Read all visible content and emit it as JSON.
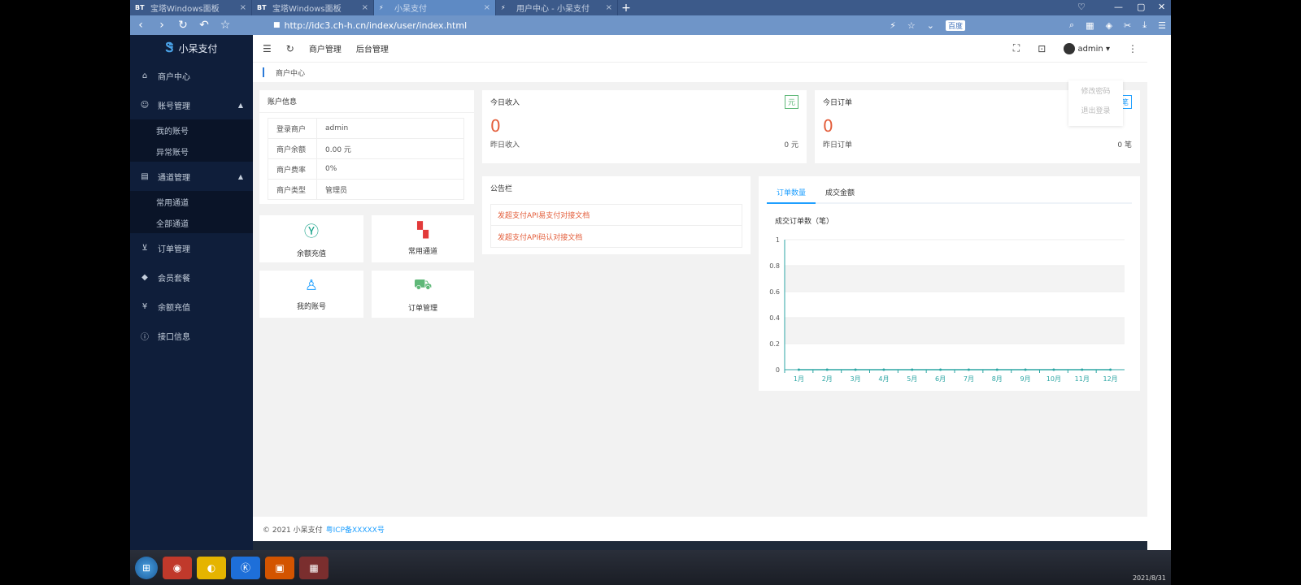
{
  "browser": {
    "tabs": [
      {
        "favicon": "BT",
        "title": "宝塔Windows面板",
        "active": false
      },
      {
        "favicon": "BT",
        "title": "宝塔Windows面板",
        "active": false
      },
      {
        "favicon": "",
        "title": "小呆支付",
        "active": true
      },
      {
        "favicon": "",
        "title": "用户中心 - 小呆支付",
        "active": false
      }
    ],
    "url": "http://idc3.ch-h.cn/index/user/index.html",
    "search_engine": "百度"
  },
  "sidebar": {
    "brand": "小呆支付",
    "items": [
      {
        "label": "商户中心",
        "icon": "home-icon"
      },
      {
        "label": "账号管理",
        "icon": "user-icon",
        "expanded": true,
        "children": [
          "我的账号",
          "异常账号"
        ]
      },
      {
        "label": "通道管理",
        "icon": "channel-icon",
        "expanded": true,
        "children": [
          "常用通道",
          "全部通道"
        ]
      },
      {
        "label": "订单管理",
        "icon": "cart-icon"
      },
      {
        "label": "会员套餐",
        "icon": "diamond-icon"
      },
      {
        "label": "余额充值",
        "icon": "yen-icon"
      },
      {
        "label": "接口信息",
        "icon": "info-icon"
      }
    ]
  },
  "topnav": {
    "links": [
      "商户管理",
      "后台管理"
    ],
    "username": "admin",
    "dropdown": [
      "修改密码",
      "退出登录"
    ]
  },
  "breadcrumb": "商户中心",
  "account": {
    "title": "账户信息",
    "rows": [
      {
        "label": "登录商户",
        "value": "admin"
      },
      {
        "label": "商户余额",
        "value": "0.00 元"
      },
      {
        "label": "商户费率",
        "value": "0%"
      },
      {
        "label": "商户类型",
        "value": "管理员"
      }
    ]
  },
  "quick": [
    {
      "label": "余额充值",
      "icon": "yen-circle-icon",
      "color": "#1aa38a"
    },
    {
      "label": "常用通道",
      "icon": "grid-icon",
      "color": "#e23a3a"
    },
    {
      "label": "我的账号",
      "icon": "account-icon",
      "color": "#1e9fff"
    },
    {
      "label": "订单管理",
      "icon": "cart-icon",
      "color": "#5fb878"
    }
  ],
  "income": {
    "title": "今日收入",
    "badge": "元",
    "value": "0",
    "sub_label": "昨日收入",
    "sub_value": "0 元"
  },
  "orders": {
    "title": "今日订单",
    "badge": "笔",
    "value": "0",
    "sub_label": "昨日订单",
    "sub_value": "0 笔"
  },
  "notice": {
    "title": "公告栏",
    "items": [
      "发超支付API易支付对接文档",
      "发超支付API码认对接文档"
    ]
  },
  "chart_tabs": [
    "订单数量",
    "成交金额"
  ],
  "chart_data": {
    "type": "line",
    "title": "成交订单数（笔）",
    "categories": [
      "1月",
      "2月",
      "3月",
      "4月",
      "5月",
      "6月",
      "7月",
      "8月",
      "9月",
      "10月",
      "11月",
      "12月"
    ],
    "values": [
      0,
      0,
      0,
      0,
      0,
      0,
      0,
      0,
      0,
      0,
      0,
      0
    ],
    "y_ticks": [
      "0",
      "0.2",
      "0.4",
      "0.6",
      "0.8",
      "1"
    ],
    "ylim": [
      0,
      1
    ],
    "color": "#2ca6a4"
  },
  "footer": {
    "text": "© 2021 小呆支付",
    "link": "粤ICP备XXXXX号"
  },
  "taskbar": {
    "clock": "2021/8/31"
  }
}
